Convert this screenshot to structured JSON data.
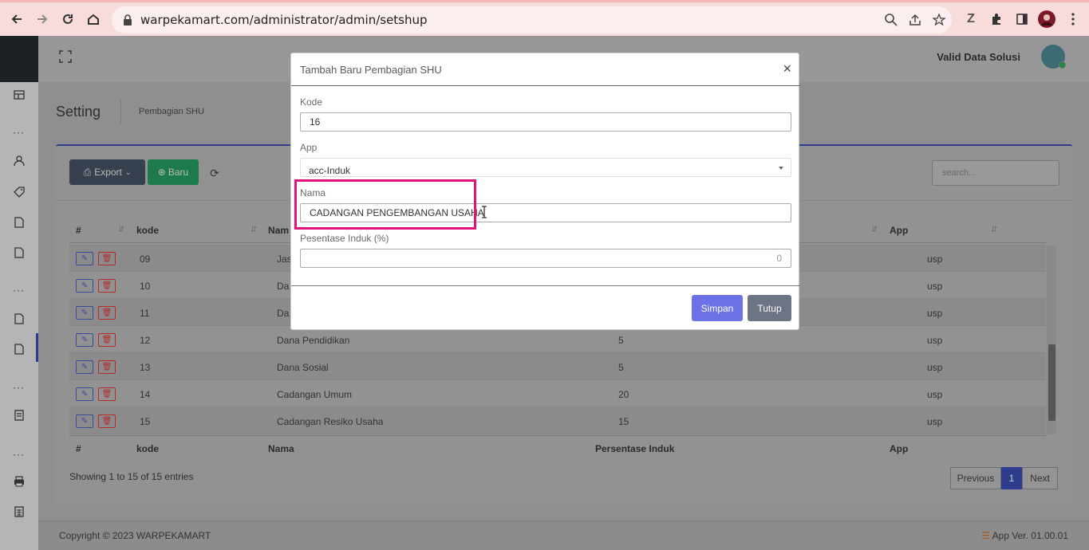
{
  "browser": {
    "url": "warpekamart.com/administrator/admin/setshup"
  },
  "header": {
    "user_name": "Valid Data Solusi"
  },
  "page": {
    "title": "Setting",
    "subtitle": "Pembagian SHU"
  },
  "toolbar": {
    "export_label": "Export",
    "new_label": "Baru",
    "search_placeholder": "search..."
  },
  "table": {
    "columns": [
      "#",
      "kode",
      "Nama",
      "Persentase Induk",
      "App"
    ],
    "header_visible": [
      "#",
      "kode",
      "Nam",
      "App"
    ],
    "rows": [
      {
        "kode": "09",
        "nama": "Jas",
        "persen": "",
        "app": "usp"
      },
      {
        "kode": "10",
        "nama": "Da",
        "persen": "",
        "app": "usp"
      },
      {
        "kode": "11",
        "nama": "Da",
        "persen": "",
        "app": "usp"
      },
      {
        "kode": "12",
        "nama": "Dana Pendidikan",
        "persen": "5",
        "app": "usp"
      },
      {
        "kode": "13",
        "nama": "Dana Sosial",
        "persen": "5",
        "app": "usp"
      },
      {
        "kode": "14",
        "nama": "Cadangan Umum",
        "persen": "20",
        "app": "usp"
      },
      {
        "kode": "15",
        "nama": "Cadangan Resiko Usaha",
        "persen": "15",
        "app": "usp"
      }
    ],
    "entries_info": "Showing 1 to 15 of 15 entries",
    "pagination": {
      "previous": "Previous",
      "current": "1",
      "next": "Next"
    }
  },
  "footer": {
    "copyright": "Copyright © 2023 WARPEKAMART",
    "version": "App Ver. 01.00.01"
  },
  "modal": {
    "title": "Tambah Baru Pembagian SHU",
    "close": "×",
    "fields": {
      "kode_label": "Kode",
      "kode_value": "16",
      "app_label": "App",
      "app_value": "acc-Induk",
      "nama_label": "Nama",
      "nama_value": "CADANGAN PENGEMBANGAN USAHA",
      "persen_label": "Pesentase Induk (%)",
      "persen_value": "0"
    },
    "save_label": "Simpan",
    "close_label": "Tutup"
  },
  "colors": {
    "primary": "#6a72e6",
    "highlight": "#e0147a",
    "accent": "#2d3c8c"
  }
}
